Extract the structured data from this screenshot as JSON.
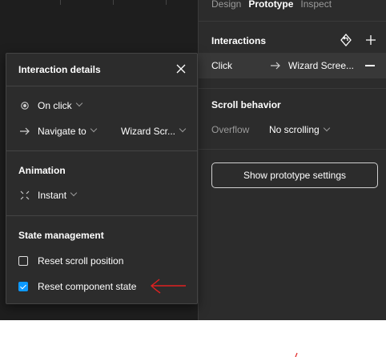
{
  "panel": {
    "tabs": [
      {
        "label": "Design",
        "active": false
      },
      {
        "label": "Prototype",
        "active": true
      },
      {
        "label": "Inspect",
        "active": false
      }
    ],
    "interactions": {
      "title": "Interactions",
      "row": {
        "trigger": "Click",
        "destination": "Wizard Scree..."
      }
    },
    "scroll_behavior": {
      "title": "Scroll behavior",
      "overflow_label": "Overflow",
      "overflow_value": "No scrolling"
    },
    "prototype_settings_button": "Show prototype settings"
  },
  "dialog": {
    "title": "Interaction details",
    "trigger": "On click",
    "action": "Navigate to",
    "destination": "Wizard Scr...",
    "animation": {
      "title": "Animation",
      "value": "Instant"
    },
    "state_management": {
      "title": "State management",
      "reset_scroll": {
        "label": "Reset scroll position",
        "checked": false
      },
      "reset_component": {
        "label": "Reset component state",
        "checked": true
      }
    }
  },
  "colors": {
    "accent": "#0d99ff",
    "annotation": "#e02020",
    "panel_bg": "#2c2c2c",
    "canvas_bg": "#1e1e1e"
  }
}
